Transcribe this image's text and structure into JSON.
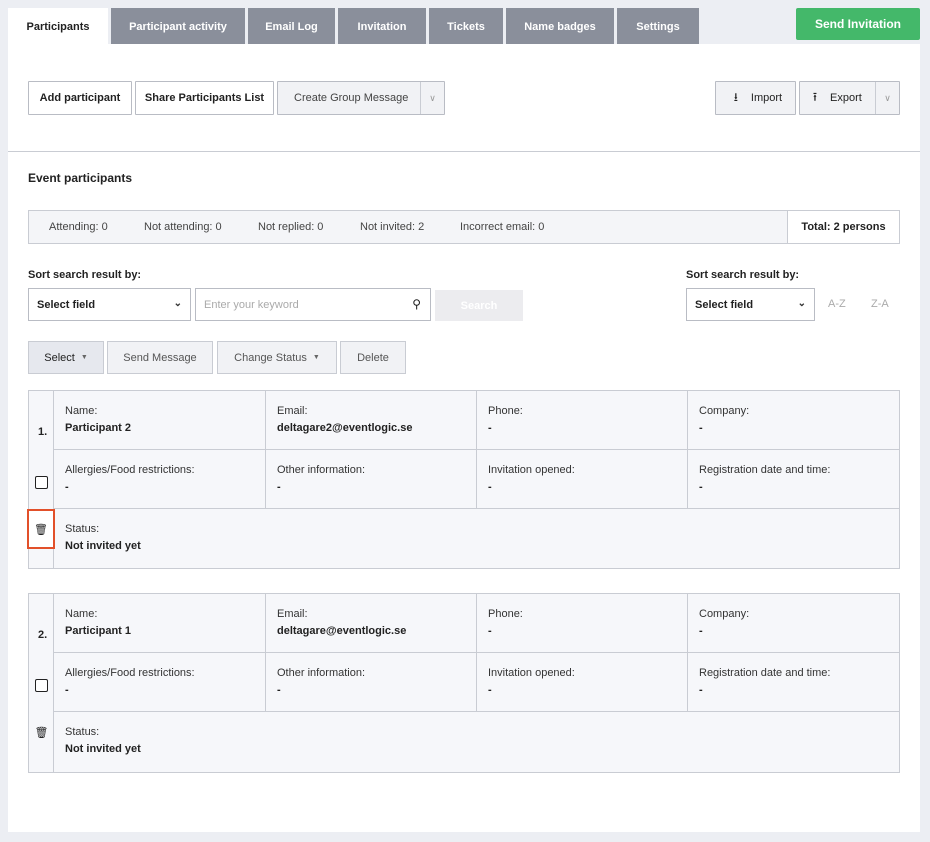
{
  "tabs": [
    "Participants",
    "Participant activity",
    "Email Log",
    "Invitation",
    "Tickets",
    "Name badges",
    "Settings"
  ],
  "send_invitation": "Send Invitation",
  "toolbar": {
    "add_participant": "Add participant",
    "share_list": "Share Participants List",
    "group_message": "Create Group Message",
    "import": "Import",
    "export": "Export"
  },
  "section_title": "Event participants",
  "stats": {
    "attending": "Attending: 0",
    "not_attending": "Not attending: 0",
    "not_replied": "Not replied: 0",
    "not_invited": "Not invited: 2",
    "incorrect_email": "Incorrect email: 0",
    "total": "Total: 2 persons"
  },
  "search": {
    "sort_label_left": "Sort search result by:",
    "select_field": "Select field",
    "keyword_placeholder": "Enter your keyword",
    "search_button": "Search",
    "sort_label_right": "Sort search result by:",
    "select_field_right": "Select field",
    "az": "A-Z",
    "za": "Z-A"
  },
  "actions": {
    "select": "Select",
    "send_message": "Send Message",
    "change_status": "Change Status",
    "delete": "Delete"
  },
  "labels": {
    "name": "Name:",
    "email": "Email:",
    "phone": "Phone:",
    "company": "Company:",
    "allergies": "Allergies/Food restrictions:",
    "other": "Other information:",
    "invitation_opened": "Invitation opened:",
    "registration": "Registration date and time:",
    "status": "Status:"
  },
  "participants": [
    {
      "index": "1.",
      "name": "Participant 2",
      "email": "deltagare2@eventlogic.se",
      "phone": "-",
      "company": "-",
      "allergies": "-",
      "other": "-",
      "invitation_opened": "-",
      "registration": "-",
      "status": "Not invited yet"
    },
    {
      "index": "2.",
      "name": "Participant 1",
      "email": "deltagare@eventlogic.se",
      "phone": "-",
      "company": "-",
      "allergies": "-",
      "other": "-",
      "invitation_opened": "-",
      "registration": "-",
      "status": "Not invited yet"
    }
  ],
  "colors": {
    "send_invitation": "#44b86a",
    "tab_inactive": "#8a8f9b",
    "highlight": "#e2502a"
  }
}
